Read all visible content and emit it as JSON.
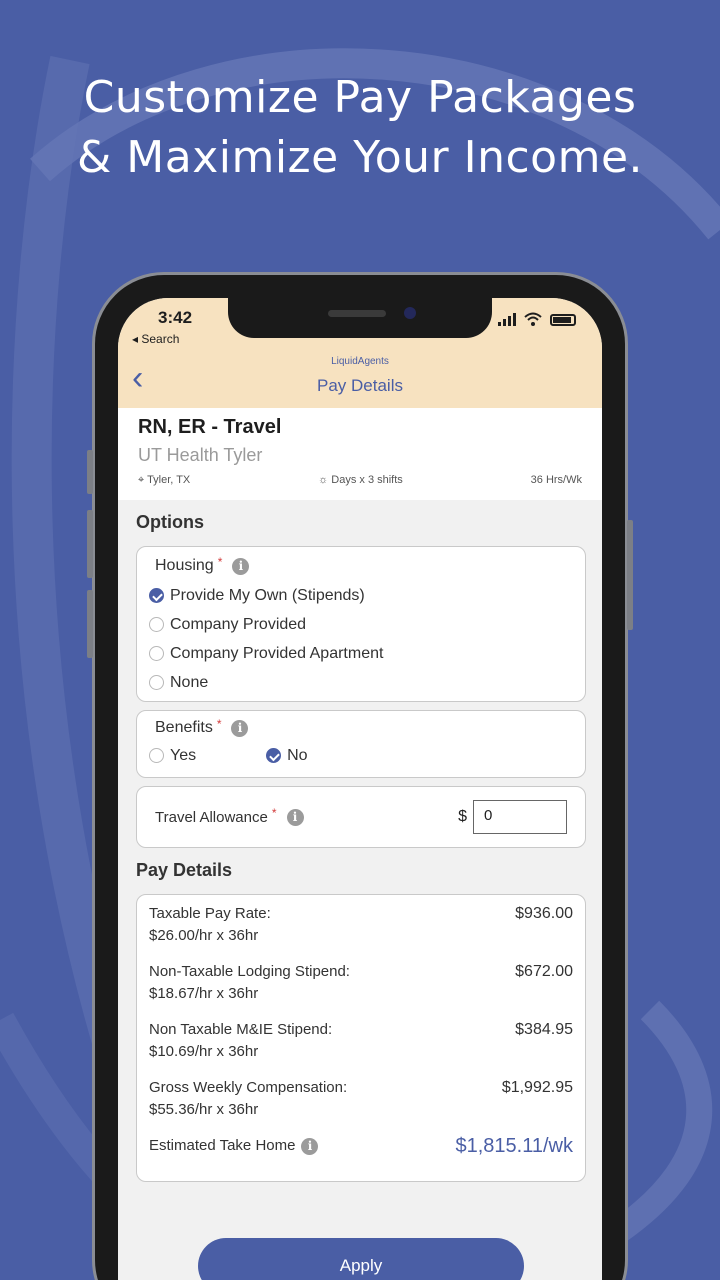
{
  "headline": {
    "line1": "Customize Pay Packages",
    "line2": "& Maximize Your Income."
  },
  "status_bar": {
    "time": "3:42",
    "back_label": "◂ Search"
  },
  "nav": {
    "logo": "LiquidAgents",
    "title": "Pay Details",
    "back_icon": "chevron-left-icon"
  },
  "job": {
    "title": "RN, ER - Travel",
    "facility": "UT Health Tyler",
    "location": "Tyler, TX",
    "schedule": "Days x 3 shifts",
    "hours": "36 Hrs/Wk"
  },
  "options": {
    "section_title": "Options",
    "housing": {
      "label": "Housing",
      "required_mark": "*",
      "info_glyph": "i",
      "choices": [
        {
          "label": "Provide My Own (Stipends)",
          "selected": true
        },
        {
          "label": "Company Provided",
          "selected": false
        },
        {
          "label": "Company Provided Apartment",
          "selected": false
        },
        {
          "label": "None",
          "selected": false
        }
      ]
    },
    "benefits": {
      "label": "Benefits",
      "required_mark": "*",
      "info_glyph": "i",
      "yes_label": "Yes",
      "no_label": "No",
      "selected": "No"
    },
    "travel": {
      "label": "Travel Allowance",
      "required_mark": "*",
      "info_glyph": "i",
      "currency": "$",
      "value": "0"
    }
  },
  "pay_details": {
    "section_title": "Pay Details",
    "rows": [
      {
        "label": "Taxable Pay Rate:",
        "sub": "$26.00/hr x 36hr",
        "amount": "$936.00"
      },
      {
        "label": "Non-Taxable Lodging Stipend:",
        "sub": "$18.67/hr x 36hr",
        "amount": "$672.00"
      },
      {
        "label": "Non Taxable M&IE Stipend:",
        "sub": "$10.69/hr x 36hr",
        "amount": "$384.95"
      },
      {
        "label": "Gross Weekly Compensation:",
        "sub": "$55.36/hr x 36hr",
        "amount": "$1,992.95"
      }
    ],
    "take_home_label": "Estimated Take Home",
    "take_home_value": "$1,815.11/wk",
    "info_glyph": "i"
  },
  "apply_label": "Apply",
  "colors": {
    "brand": "#4a5ea5",
    "header_bg": "#f7e2c0",
    "required": "#d23b3b"
  }
}
